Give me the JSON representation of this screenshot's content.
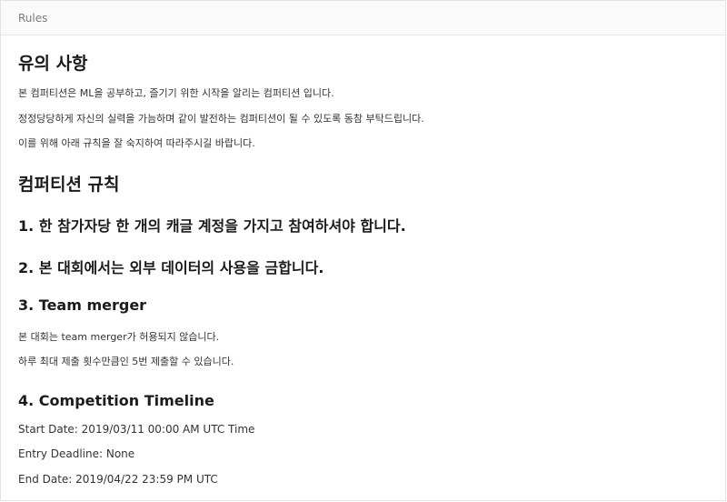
{
  "header": {
    "title": "Rules"
  },
  "notice": {
    "title": "유의 사항",
    "lines": [
      "본 컴퍼티션은 ML을 공부하고, 즐기기 위한 시작을 알리는 컴퍼티션 입니다.",
      "정정당당하게 자신의 실력을 가늠하며 같이 발전하는 컴퍼티션이 될 수 있도록 동참 부탁드립니다.",
      "이를 위해 아래 규칙을 잘 숙지하여 따라주시길 바랍니다."
    ]
  },
  "rules": {
    "title": "컴퍼티션 규칙",
    "rule1": "1. 한 참가자당 한 개의 캐글 계정을 가지고 참여하셔야 합니다.",
    "rule2": "2. 본 대회에서는 외부 데이터의 사용을 금합니다.",
    "rule3": {
      "title": "3. Team merger",
      "lines": [
        "본 대회는 team merger가 허용되지 않습니다.",
        "하루 최대 제출 횟수만큼인 5번 제출할 수 있습니다."
      ]
    },
    "rule4": {
      "title": "4. Competition Timeline",
      "lines": [
        "Start Date: 2019/03/11 00:00 AM UTC Time",
        "Entry Deadline: None",
        "End Date: 2019/04/22 23:59 PM UTC"
      ]
    }
  }
}
